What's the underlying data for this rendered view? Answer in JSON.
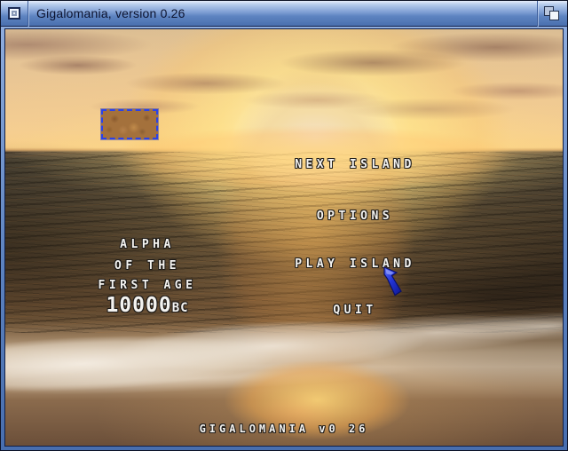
{
  "window": {
    "title": "Gigalomania, version 0.26"
  },
  "titlebar": {
    "close_icon": "close-gadget",
    "depth_icon": "depth-gadget"
  },
  "menu": {
    "items": [
      {
        "id": "next-island",
        "label": "NEXT ISLAND"
      },
      {
        "id": "options",
        "label": "OPTIONS"
      },
      {
        "id": "play-island",
        "label": "PLAY ISLAND"
      },
      {
        "id": "quit",
        "label": "QUIT"
      }
    ]
  },
  "epoch": {
    "line1": "ALPHA",
    "line2": "OF THE",
    "line3": "FIRST AGE",
    "year": "10000",
    "era": "BC"
  },
  "footer": {
    "version_text": "GIGALOMANIA v0 26"
  },
  "island_preview": {
    "description": "island-map-thumbnail-selected"
  },
  "cursor": {
    "icon": "blue-arrow-cursor"
  },
  "colors": {
    "titlebar_top": "#b7cdec",
    "titlebar_bottom": "#4a70af",
    "frame_blue": "#5d83c0",
    "selection_border": "#2b42e8",
    "cursor_blue": "#2233cc",
    "text_white": "#f4f3f0"
  }
}
